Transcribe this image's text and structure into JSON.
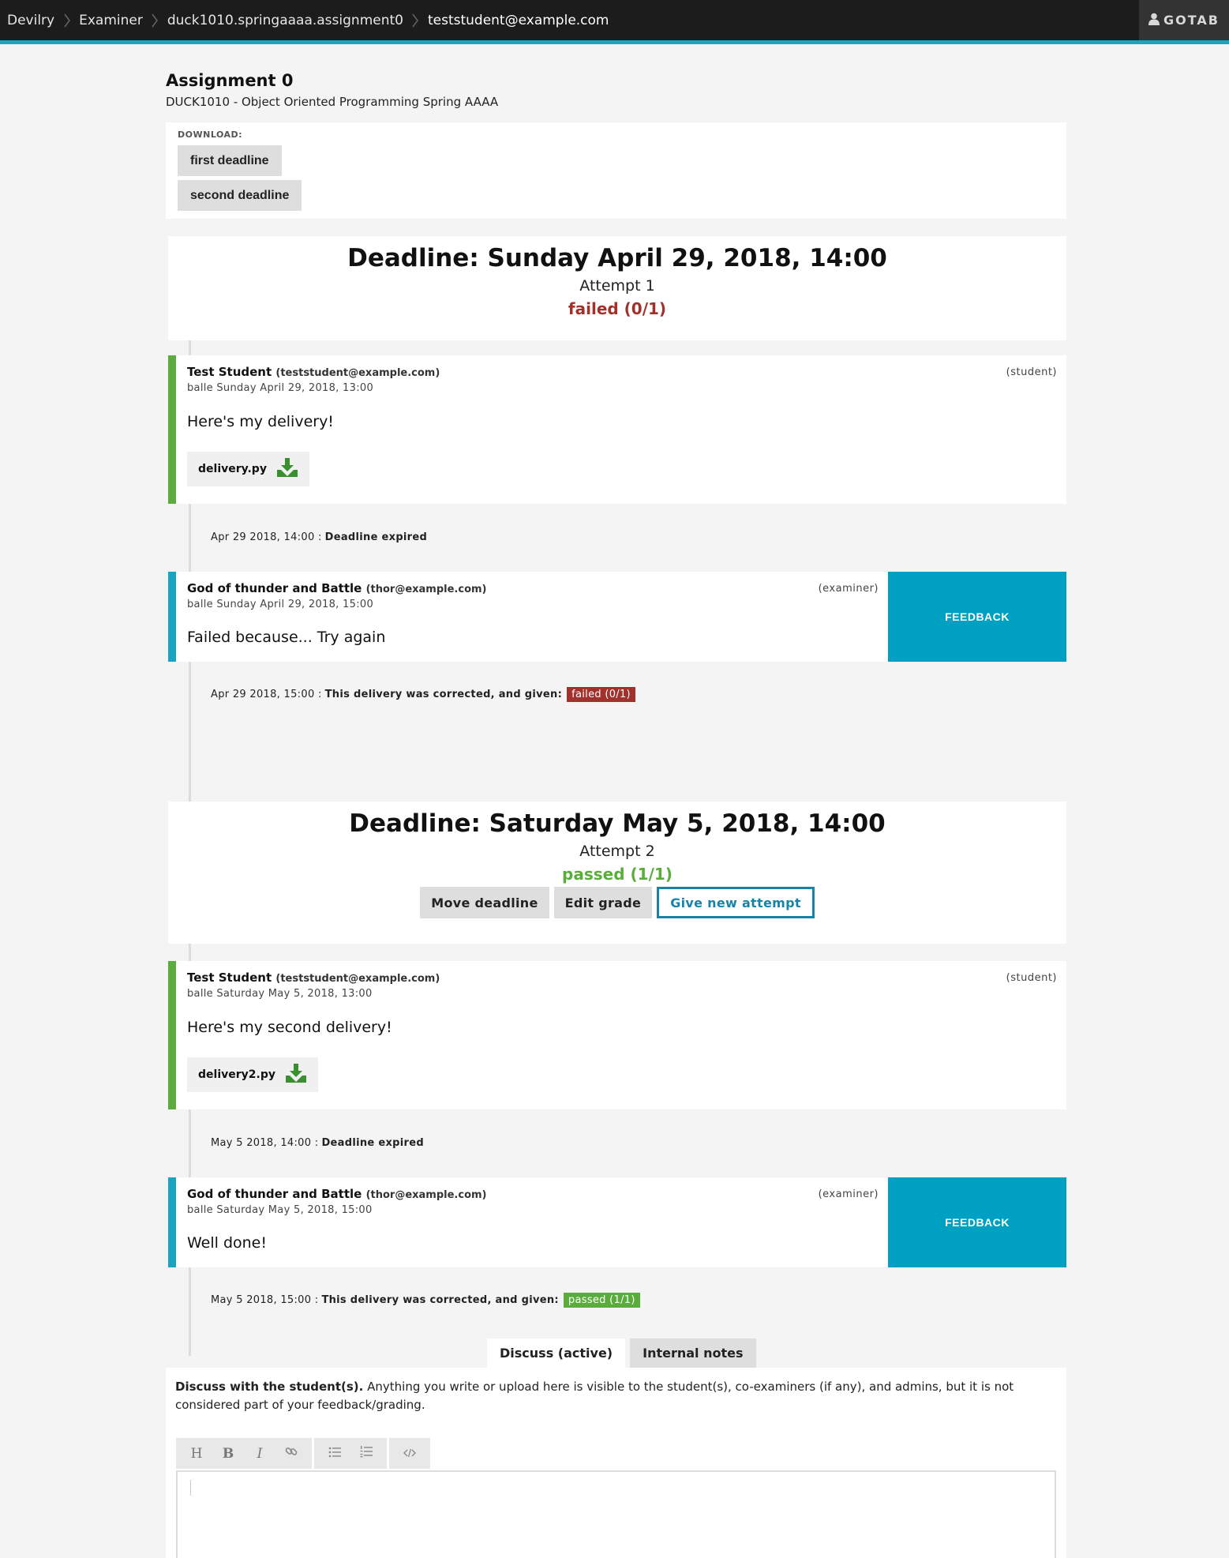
{
  "nav": {
    "crumbs": [
      "Devilry",
      "Examiner",
      "duck1010.springaaaa.assignment0",
      "teststudent@example.com"
    ],
    "user": "GOTAB"
  },
  "assignment": {
    "title": "Assignment 0",
    "subtitle": "DUCK1010 - Object Oriented Programming Spring AAAA"
  },
  "download": {
    "label": "DOWNLOAD:",
    "buttons": [
      "first deadline",
      "second deadline"
    ]
  },
  "deadlines": [
    {
      "title": "Deadline: Sunday April 29, 2018, 14:00",
      "attempt": "Attempt 1",
      "grade": "failed (0/1)",
      "student_msg": {
        "author": "Test Student",
        "email": "(teststudent@example.com)",
        "role": "(student)",
        "date": "balle Sunday April 29, 2018, 13:00",
        "text": "Here's my delivery!",
        "file": "delivery.py"
      },
      "expired_event": {
        "date": "Apr 29 2018, 14:00 :",
        "text": "Deadline expired"
      },
      "examiner_msg": {
        "author": "God of thunder and Battle",
        "email": "(thor@example.com)",
        "role": "(examiner)",
        "date": "balle Sunday April 29, 2018, 15:00",
        "text": "Failed because... Try again",
        "feedback": "FEEDBACK"
      },
      "graded_event": {
        "date": "Apr 29 2018, 15:00 :",
        "text": "This delivery was corrected, and given:",
        "tag": "failed (0/1)"
      }
    },
    {
      "title": "Deadline: Saturday May 5, 2018, 14:00",
      "attempt": "Attempt 2",
      "grade": "passed (1/1)",
      "actions": [
        "Move deadline",
        "Edit grade",
        "Give new attempt"
      ],
      "student_msg": {
        "author": "Test Student",
        "email": "(teststudent@example.com)",
        "role": "(student)",
        "date": "balle Saturday May 5, 2018, 13:00",
        "text": "Here's my second delivery!",
        "file": "delivery2.py"
      },
      "expired_event": {
        "date": "May 5 2018, 14:00 :",
        "text": "Deadline expired"
      },
      "examiner_msg": {
        "author": "God of thunder and Battle",
        "email": "(thor@example.com)",
        "role": "(examiner)",
        "date": "balle Saturday May 5, 2018, 15:00",
        "text": "Well done!",
        "feedback": "FEEDBACK"
      },
      "graded_event": {
        "date": "May 5 2018, 15:00 :",
        "text": "This delivery was corrected, and given:",
        "tag": "passed (1/1)"
      }
    }
  ],
  "tabs": [
    "Discuss (active)",
    "Internal notes"
  ],
  "discuss": {
    "lead": "Discuss with the student(s).",
    "text": "Anything you write or upload here is visible to the student(s), co-examiners (if any), and admins, but it is not considered part of your feedback/grading."
  },
  "toolbar": {
    "heading": "H",
    "bold": "B",
    "italic": "I"
  },
  "colors": {
    "accent": "#1aa3c2",
    "pass": "#5aad3c",
    "fail": "#a0312c",
    "feedback": "#00a0c2"
  },
  "icons": [
    "chevron-right-icon",
    "user-icon",
    "download-icon",
    "link-icon",
    "bulleted-list-icon",
    "numbered-list-icon",
    "code-icon"
  ]
}
